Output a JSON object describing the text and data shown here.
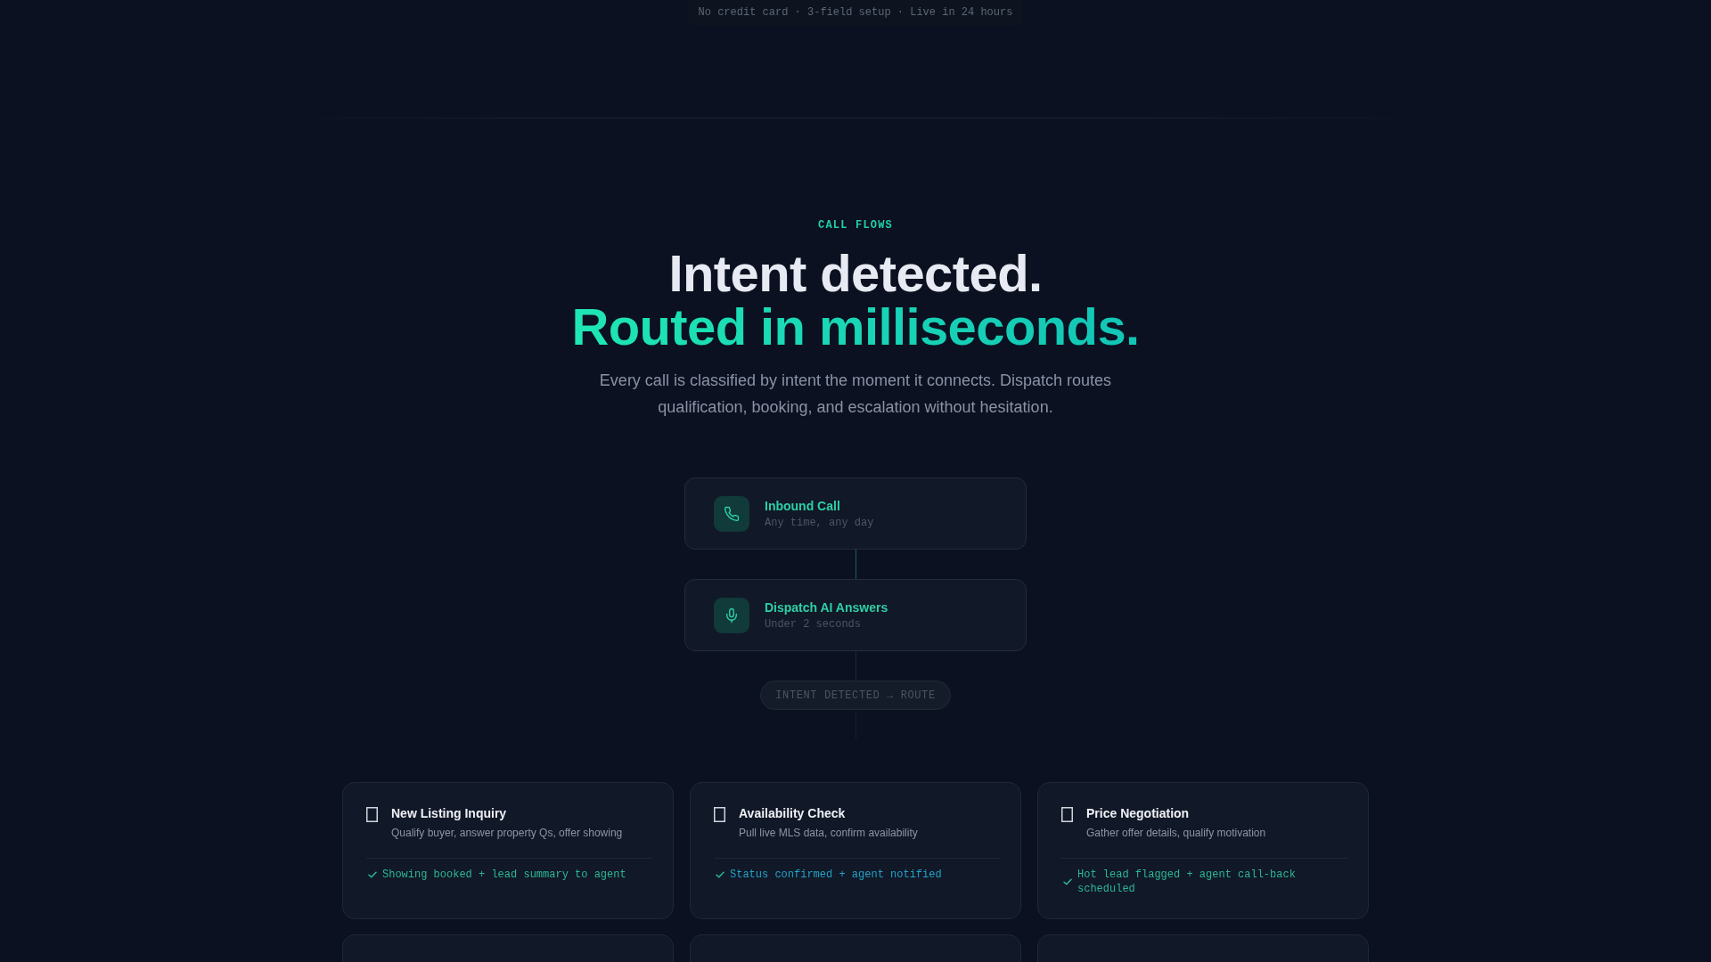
{
  "setup_note": "No credit card · 3-field setup · Live in 24 hours",
  "section": {
    "eyebrow": "CALL FLOWS",
    "heading": "Intent detected.",
    "heading_accent": "Routed in milliseconds.",
    "subtitle": "Every call is classified by intent the moment it connects. Dispatch routes qualification, booking, and escalation without hesitation."
  },
  "flow": {
    "steps": [
      {
        "kind": "call",
        "title": "Inbound Call",
        "detail": "Any time, any day"
      },
      {
        "kind": "voice",
        "title": "Dispatch AI Answers",
        "detail": "Under 2 seconds"
      }
    ],
    "route_label": "INTENT DETECTED → ROUTE"
  },
  "intents": [
    {
      "title": "New Listing Inquiry",
      "description": "Qualify buyer, answer property Qs, offer showing",
      "outcome": "Showing booked + lead summary to agent",
      "color": "#2bb894"
    },
    {
      "title": "Availability Check",
      "description": "Pull live MLS data, confirm availability",
      "outcome": "Status confirmed + agent notified",
      "color": "#22a3c6"
    },
    {
      "title": "Price Negotiation",
      "description": "Gather offer details, qualify motivation",
      "outcome": "Hot lead flagged + agent call-back scheduled",
      "color": "#2bb894"
    }
  ]
}
